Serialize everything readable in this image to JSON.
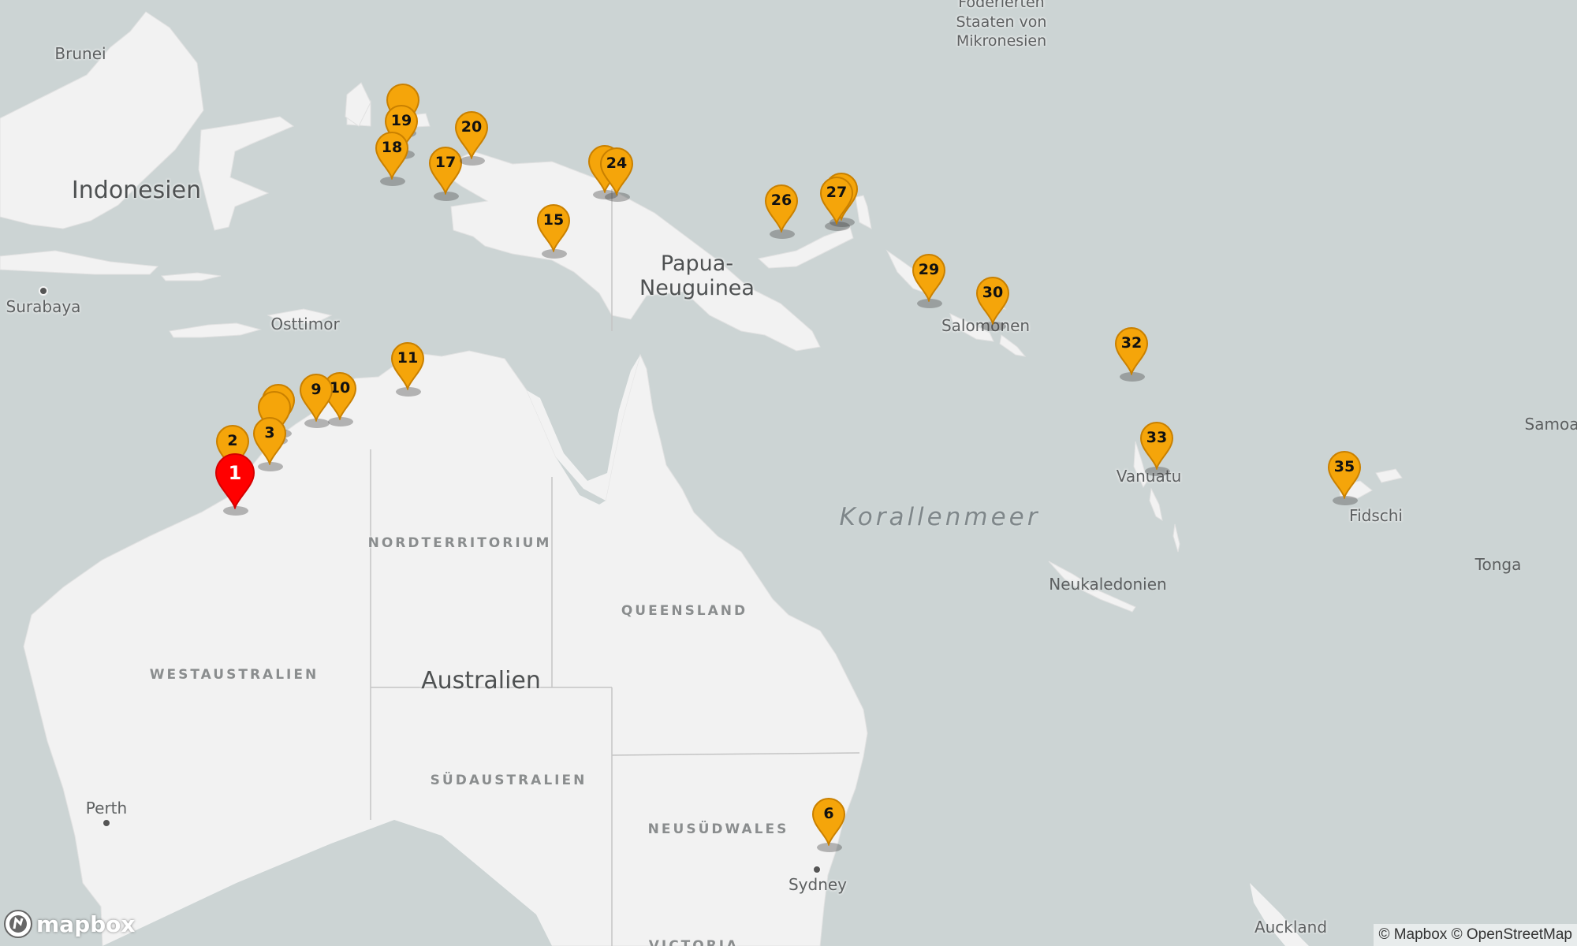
{
  "map": {
    "colors": {
      "water": "#ccd4d4",
      "land": "#f2f2f2",
      "border": "#c4c4c4",
      "marker": "#f5a50a",
      "marker_stroke": "#c98000",
      "marker_active": "#ff0000"
    },
    "labels": {
      "brunei": "Brunei",
      "indonesia": "Indonesien",
      "surabaya": "Surabaya",
      "osttimor": "Osttimor",
      "png": "Papua-\nNeuguinea",
      "micronesia": "Föderierten\nStaaten von\nMikronesien",
      "solomons": "Salomonen",
      "vanuatu": "Vanuatu",
      "fiji": "Fidschi",
      "samoa": "Samoa",
      "tonga": "Tonga",
      "new_caledonia": "Neukaledonien",
      "coral_sea": "Korallenmeer",
      "australia": "Australien",
      "nt": "NORDTERRITORIUM",
      "qld": "QUEENSLAND",
      "wa": "WESTAUSTRALIEN",
      "sa": "SÜDAUSTRALIEN",
      "nsw": "NEUSÜDWALES",
      "vic": "VICTORIA",
      "perth": "Perth",
      "sydney": "Sydney",
      "auckland": "Auckland"
    },
    "markers": [
      {
        "label": "2",
        "active": false
      },
      {
        "label": "3",
        "active": false
      },
      {
        "label": "9",
        "active": false
      },
      {
        "label": "10",
        "active": false
      },
      {
        "label": "11",
        "active": false
      },
      {
        "label": "15",
        "active": false
      },
      {
        "label": "17",
        "active": false
      },
      {
        "label": "18",
        "active": false
      },
      {
        "label": "19",
        "active": false
      },
      {
        "label": "20",
        "active": false
      },
      {
        "label": "24",
        "active": false
      },
      {
        "label": "26",
        "active": false
      },
      {
        "label": "27",
        "active": false
      },
      {
        "label": "29",
        "active": false
      },
      {
        "label": "30",
        "active": false
      },
      {
        "label": "32",
        "active": false
      },
      {
        "label": "33",
        "active": false
      },
      {
        "label": "35",
        "active": false
      },
      {
        "label": "6",
        "active": false
      },
      {
        "label": "1",
        "active": true
      }
    ],
    "logo_text": "mapbox",
    "attribution": "© Mapbox © OpenStreetMap"
  }
}
